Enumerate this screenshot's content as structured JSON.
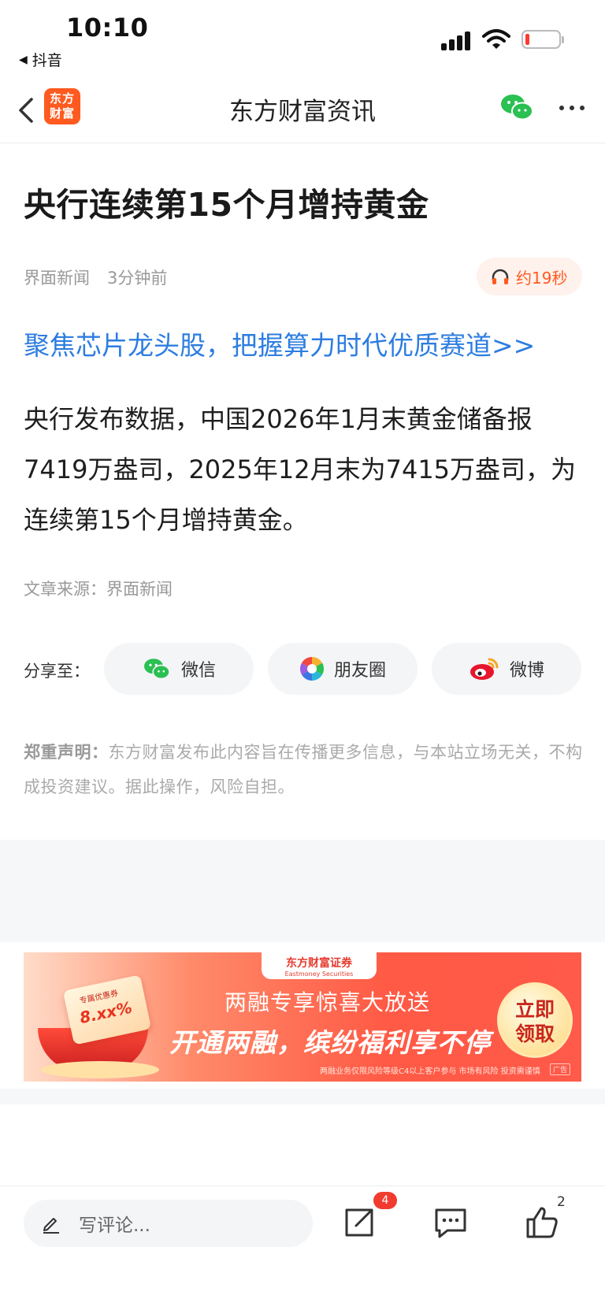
{
  "status_bar": {
    "time": "10:10",
    "back_app": "抖音"
  },
  "nav": {
    "logo_line1": "东方",
    "logo_line2": "财富",
    "title": "东方财富资讯"
  },
  "article": {
    "title": "央行连续第15个月增持黄金",
    "source_name": "界面新闻",
    "time_ago": "3分钟前",
    "listen_label": "约19秒",
    "promo_link": "聚焦芯片龙头股，把握算力时代优质赛道>>",
    "body": "央行发布数据，中国2026年1月末黄金储备报7419万盎司，2025年12月末为7415万盎司，为连续第15个月增持黄金。",
    "source_line": "文章来源：界面新闻"
  },
  "share": {
    "label": "分享至：",
    "wechat": "微信",
    "moments": "朋友圈",
    "weibo": "微博"
  },
  "disclaimer": {
    "label": "郑重声明：",
    "text": "东方财富发布此内容旨在传播更多信息，与本站立场无关，不构成投资建议。据此操作，风险自担。"
  },
  "ad": {
    "brand_cn": "东方财富证券",
    "brand_en": "Eastmoney Securities",
    "headline1": "两融专享惊喜大放送",
    "headline2": "开通两融，缤纷福利享不停",
    "cta_line1": "立即",
    "cta_line2": "领取",
    "coupon_top": "专属优惠券",
    "coupon_value": "8.xx%",
    "fineprint": "两融业务仅限风险等级C4以上客户参与  市场有风险  投资需谨慎",
    "tag": "广告"
  },
  "bottom_bar": {
    "comment_placeholder": "写评论...",
    "share_badge": "4",
    "like_count": "2"
  },
  "colors": {
    "accent": "#ff5a1f",
    "link": "#2d7de0",
    "badge": "#f23b2f",
    "wechat_green": "#2ac052"
  }
}
